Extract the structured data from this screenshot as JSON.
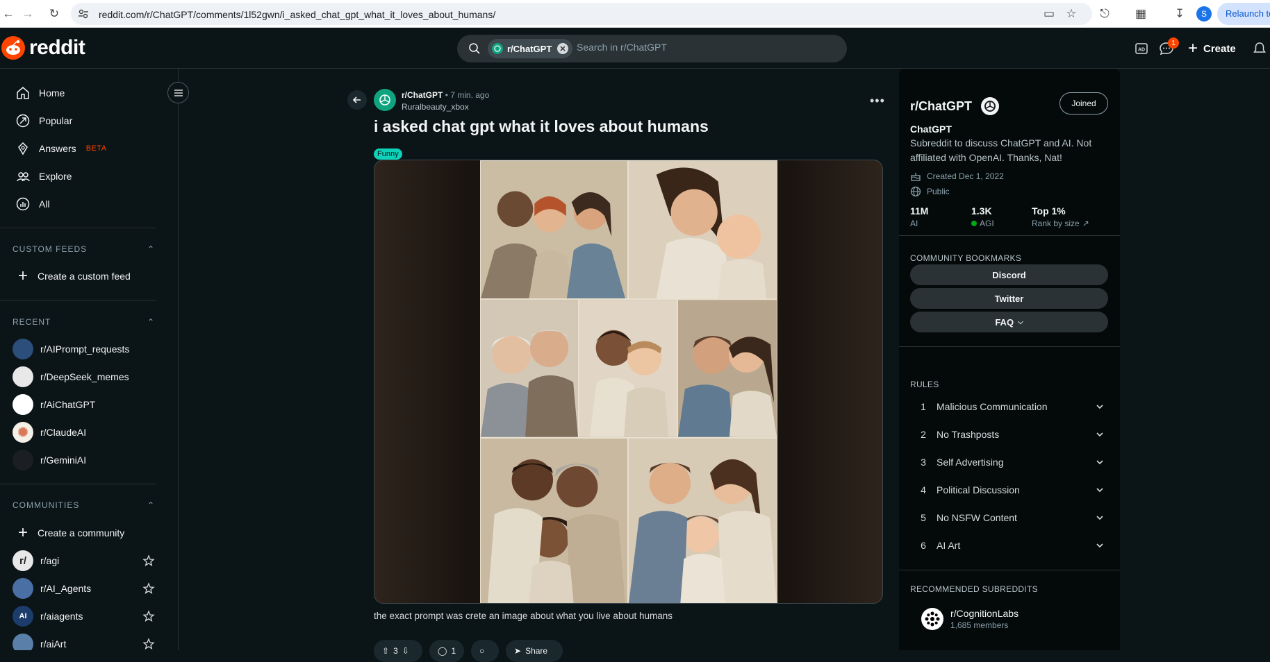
{
  "browser": {
    "url": "reddit.com/r/ChatGPT/comments/1l52gwn/i_asked_chat_gpt_what_it_loves_about_humans/",
    "profile_initial": "S",
    "relaunch_label": "Relaunch to"
  },
  "header": {
    "logo_text": "reddit",
    "search_chip": "r/ChatGPT",
    "search_placeholder": "Search in r/ChatGPT",
    "chat_badge": "1",
    "create_label": "Create"
  },
  "sidebar": {
    "nav": [
      {
        "label": "Home",
        "icon": "home-icon"
      },
      {
        "label": "Popular",
        "icon": "popular-icon"
      },
      {
        "label": "Answers",
        "icon": "answers-icon",
        "tag": "BETA"
      },
      {
        "label": "Explore",
        "icon": "explore-icon"
      },
      {
        "label": "All",
        "icon": "all-icon"
      }
    ],
    "custom_feeds_header": "CUSTOM FEEDS",
    "create_custom_feed": "Create a custom feed",
    "recent_header": "RECENT",
    "recent": [
      {
        "name": "r/AIPrompt_requests",
        "color": "#2b4f7a"
      },
      {
        "name": "r/DeepSeek_memes",
        "color": "#e8e8e8"
      },
      {
        "name": "r/AiChatGPT",
        "color": "#ffffff"
      },
      {
        "name": "r/ClaudeAI",
        "color": "#f4f0e8"
      },
      {
        "name": "r/GeminiAI",
        "color": "#1b1f23"
      }
    ],
    "communities_header": "COMMUNITIES",
    "create_community": "Create a community",
    "communities": [
      {
        "name": "r/agi",
        "avatar_text": "r/",
        "color": "#e8e8e8"
      },
      {
        "name": "r/AI_Agents",
        "avatar_text": "",
        "color": "#4a6fa5"
      },
      {
        "name": "r/aiagents",
        "avatar_text": "AI",
        "color": "#1c3c6b"
      },
      {
        "name": "r/aiArt",
        "avatar_text": "",
        "color": "#5a7fa8"
      }
    ]
  },
  "post": {
    "subreddit": "r/ChatGPT",
    "age": "• 7 min. ago",
    "author": "Ruralbeauty_xbox",
    "title": "i asked chat gpt what it loves about humans",
    "flair": "Funny",
    "caption": "the exact prompt was crete an image about what you live about humans",
    "actions": {
      "votes": "3",
      "comments": "1",
      "share": "Share"
    }
  },
  "community": {
    "title": "r/ChatGPT",
    "joined_label": "Joined",
    "name": "ChatGPT",
    "description": "Subreddit to discuss ChatGPT and AI. Not affiliated with OpenAI. Thanks, Nat!",
    "created": "Created Dec 1, 2022",
    "visibility": "Public",
    "stats": [
      {
        "value": "11M",
        "label": "AI"
      },
      {
        "value": "1.3K",
        "label": "AGI"
      },
      {
        "value": "Top 1%",
        "label": "Rank by size"
      }
    ],
    "bookmarks_header": "COMMUNITY BOOKMARKS",
    "bookmarks": [
      "Discord",
      "Twitter",
      "FAQ"
    ],
    "rules_header": "RULES",
    "rules": [
      {
        "n": "1",
        "label": "Malicious Communication"
      },
      {
        "n": "2",
        "label": "No Trashposts"
      },
      {
        "n": "3",
        "label": "Self Advertising"
      },
      {
        "n": "4",
        "label": "Political Discussion"
      },
      {
        "n": "5",
        "label": "No NSFW Content"
      },
      {
        "n": "6",
        "label": "AI Art"
      }
    ],
    "recommended_header": "RECOMMENDED SUBREDDITS",
    "recommended": {
      "name": "r/CognitionLabs",
      "members": "1,685 members"
    }
  },
  "colors": {
    "accent": "#ff4500",
    "flair": "#0dd3bb",
    "background": "#0b1416",
    "online": "#01a816"
  }
}
